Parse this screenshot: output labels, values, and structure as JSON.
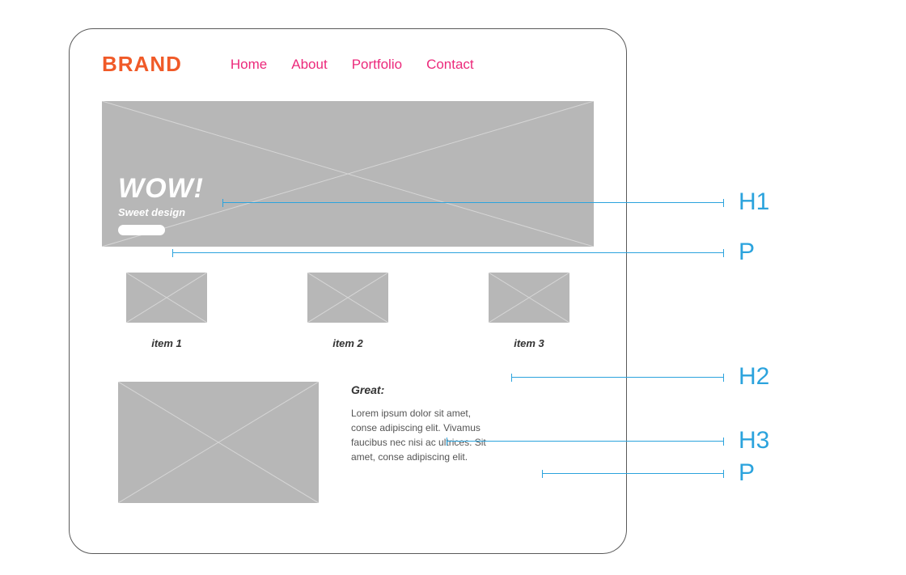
{
  "brand": "BRAND",
  "nav": {
    "home": "Home",
    "about": "About",
    "portfolio": "Portfolio",
    "contact": "Contact"
  },
  "hero": {
    "title": "WOW!",
    "subtitle": "Sweet design"
  },
  "items": [
    {
      "label": "item 1"
    },
    {
      "label": "item 2"
    },
    {
      "label": "item 3"
    }
  ],
  "detail": {
    "heading": "Great:",
    "body": "Lorem ipsum dolor sit amet, conse adipiscing elit. Vivamus faucibus nec nisi ac ultrices. Sit amet, conse adipiscing elit."
  },
  "annotations": {
    "h1": "H1",
    "p1": "P",
    "h2": "H2",
    "h3": "H3",
    "p2": "P"
  },
  "colors": {
    "brand": "#f05a28",
    "nav": "#ec297b",
    "annotation": "#2ba3dd",
    "placeholder": "#b7b7b7"
  }
}
